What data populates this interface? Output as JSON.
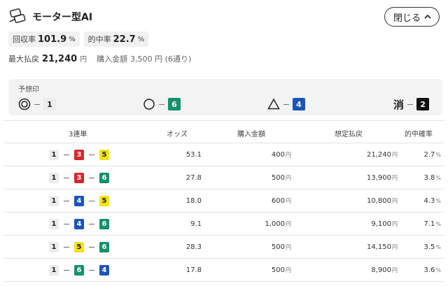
{
  "header": {
    "title": "モーター型AI",
    "close_label": "閉じる"
  },
  "stats": [
    {
      "label": "回収率",
      "value": "101.9",
      "unit": "%"
    },
    {
      "label": "的中率",
      "value": "22.7",
      "unit": "%"
    }
  ],
  "summary": {
    "max_label": "最大払戻",
    "max_value": "21,240",
    "max_unit": "円",
    "purchase_label": "購入金額",
    "purchase_value": "3,500 円 (6通り)"
  },
  "yoso": {
    "label": "予想印",
    "marks": [
      {
        "symbol": "double-circle",
        "boat": "1"
      },
      {
        "symbol": "circle",
        "boat": "6"
      },
      {
        "symbol": "triangle",
        "boat": "4"
      },
      {
        "symbol": "kei",
        "symbol_text": "消",
        "boat": "2"
      }
    ]
  },
  "table": {
    "headers": [
      "3連単",
      "オッズ",
      "購入金額",
      "想定払戻",
      "的中確率"
    ],
    "yen": "円",
    "pct": "%",
    "rows": [
      {
        "combo": [
          "1",
          "3",
          "5"
        ],
        "odds": "53.1",
        "amount": "400",
        "payout": "21,240",
        "prob": "2.7"
      },
      {
        "combo": [
          "1",
          "3",
          "6"
        ],
        "odds": "27.8",
        "amount": "500",
        "payout": "13,900",
        "prob": "3.8"
      },
      {
        "combo": [
          "1",
          "4",
          "5"
        ],
        "odds": "18.0",
        "amount": "600",
        "payout": "10,800",
        "prob": "4.3"
      },
      {
        "combo": [
          "1",
          "4",
          "6"
        ],
        "odds": "9.1",
        "amount": "1,000",
        "payout": "9,100",
        "prob": "7.1"
      },
      {
        "combo": [
          "1",
          "5",
          "6"
        ],
        "odds": "28.3",
        "amount": "500",
        "payout": "14,150",
        "prob": "3.5"
      },
      {
        "combo": [
          "1",
          "6",
          "4"
        ],
        "odds": "17.8",
        "amount": "500",
        "payout": "8,900",
        "prob": "3.6"
      }
    ]
  }
}
